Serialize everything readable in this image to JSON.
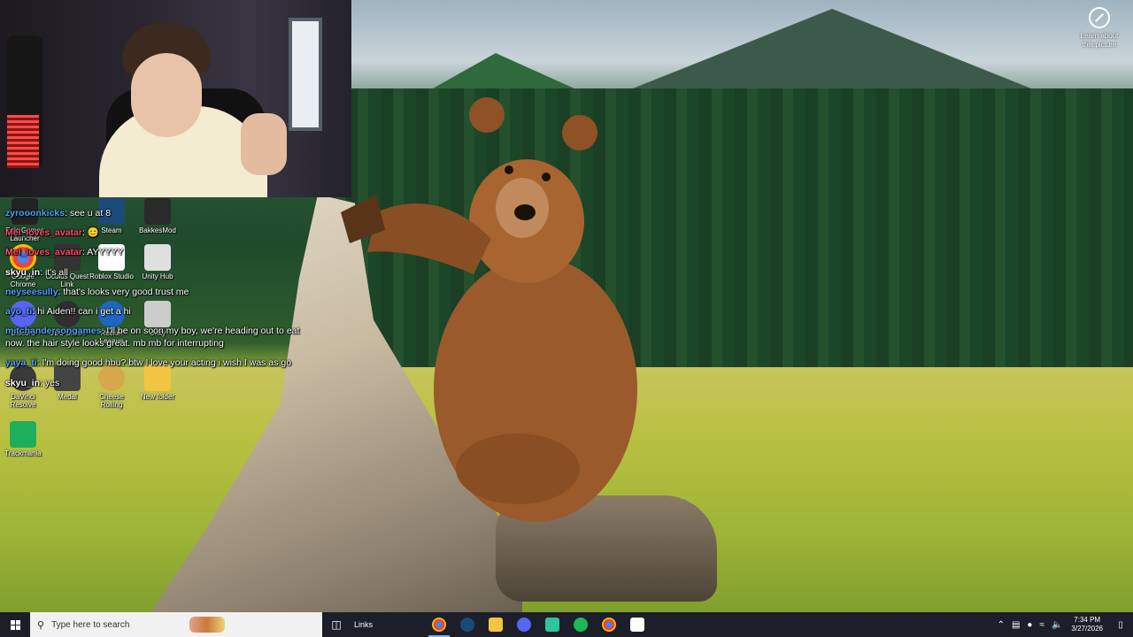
{
  "desktop": {
    "learn_about": "Learn about this picture",
    "icons": [
      {
        "label": "Epic Games Launcher",
        "icon": "epic-icon",
        "color": "#222222"
      },
      {
        "label": "Steam",
        "icon": "steam-icon",
        "color": "#1b4a78"
      },
      {
        "label": "BakkesMod",
        "icon": "bakkesmod-icon",
        "color": "#2a2a2a"
      },
      {
        "label": "Google Chrome",
        "icon": "chrome-icon",
        "color": "#e8453c"
      },
      {
        "label": "Oculus Quest Link",
        "icon": "oculus-icon",
        "color": "#333333"
      },
      {
        "label": "Roblox Studio",
        "icon": "roblox-icon",
        "color": "#ffffff"
      },
      {
        "label": "Unity Hub",
        "icon": "unity-icon",
        "color": "#dfdfdf"
      },
      {
        "label": "Discord",
        "icon": "discord-icon",
        "color": "#5865f2"
      },
      {
        "label": "OBS Studio",
        "icon": "obs-icon",
        "color": "#302e31"
      },
      {
        "label": "Rocket League",
        "icon": "rocket-league-icon",
        "color": "#1f66c2"
      },
      {
        "label": "Unity",
        "icon": "unity-cube-icon",
        "color": "#cccccc"
      },
      {
        "label": "DaVinci Resolve",
        "icon": "davinci-icon",
        "color": "#3a3a3a"
      },
      {
        "label": "Medal",
        "icon": "medal-icon",
        "color": "#444444"
      },
      {
        "label": "Cheese Rolling",
        "icon": "cheese-icon",
        "color": "#d6a84a"
      },
      {
        "label": "New folder",
        "icon": "folder-icon",
        "color": "#f4c542"
      },
      {
        "label": "Trackmania",
        "icon": "trackmania-icon",
        "color": "#1fae5b"
      }
    ]
  },
  "chat": [
    {
      "user": "zyrooonkicks",
      "text": ": see u at 8",
      "color": "#4fa3ff"
    },
    {
      "user": "Mel_loves_avatar",
      "text": ": 😊",
      "color": "#ff4a6a"
    },
    {
      "user": "Mel_loves_avatar",
      "text": ": AYYYYY",
      "color": "#ff4a6a"
    },
    {
      "user": "skyu_in",
      "text": ": it's all",
      "color": "#ffffff"
    },
    {
      "user": "neyseesully",
      "text": ": that's looks very good trust me",
      "color": "#4fa3ff"
    },
    {
      "user": "ayo_ti",
      "text": ": hi Aiden!! can i get a hi",
      "color": "#4fa3ff"
    },
    {
      "user": "mitchandersongames",
      "text": ": I'll be on soon my boy, we're heading out to eat now. the hair style looks great. mb mb for interrupting",
      "color": "#4fa3ff"
    },
    {
      "user": "yaya_ti",
      "text": ": I'm doing good hbu? btw I love your acting i wish I was as go",
      "color": "#4fa3ff"
    },
    {
      "user": "skyu_in",
      "text": ": yes",
      "color": "#ffffff"
    }
  ],
  "taskbar": {
    "search_placeholder": "Type here to search",
    "links_label": "Links",
    "apps": [
      {
        "name": "chrome",
        "icon": "chrome-icon",
        "color": "#e8453c",
        "active": true
      },
      {
        "name": "steam",
        "icon": "steam-icon",
        "color": "#1b4a78",
        "active": false
      },
      {
        "name": "file-explorer",
        "icon": "folder-icon",
        "color": "#f4c542",
        "active": false
      },
      {
        "name": "discord",
        "icon": "discord-icon",
        "color": "#5865f2",
        "active": false
      },
      {
        "name": "game",
        "icon": "game-icon",
        "color": "#2ec4a0",
        "active": false
      },
      {
        "name": "spotify",
        "icon": "spotify-icon",
        "color": "#1db954",
        "active": false
      },
      {
        "name": "chrome-2",
        "icon": "chrome-icon",
        "color": "#e8453c",
        "active": false
      },
      {
        "name": "medal",
        "icon": "medal-icon",
        "color": "#ffffff",
        "active": false
      }
    ],
    "time": "7:34 PM",
    "date": "3/27/2026"
  }
}
